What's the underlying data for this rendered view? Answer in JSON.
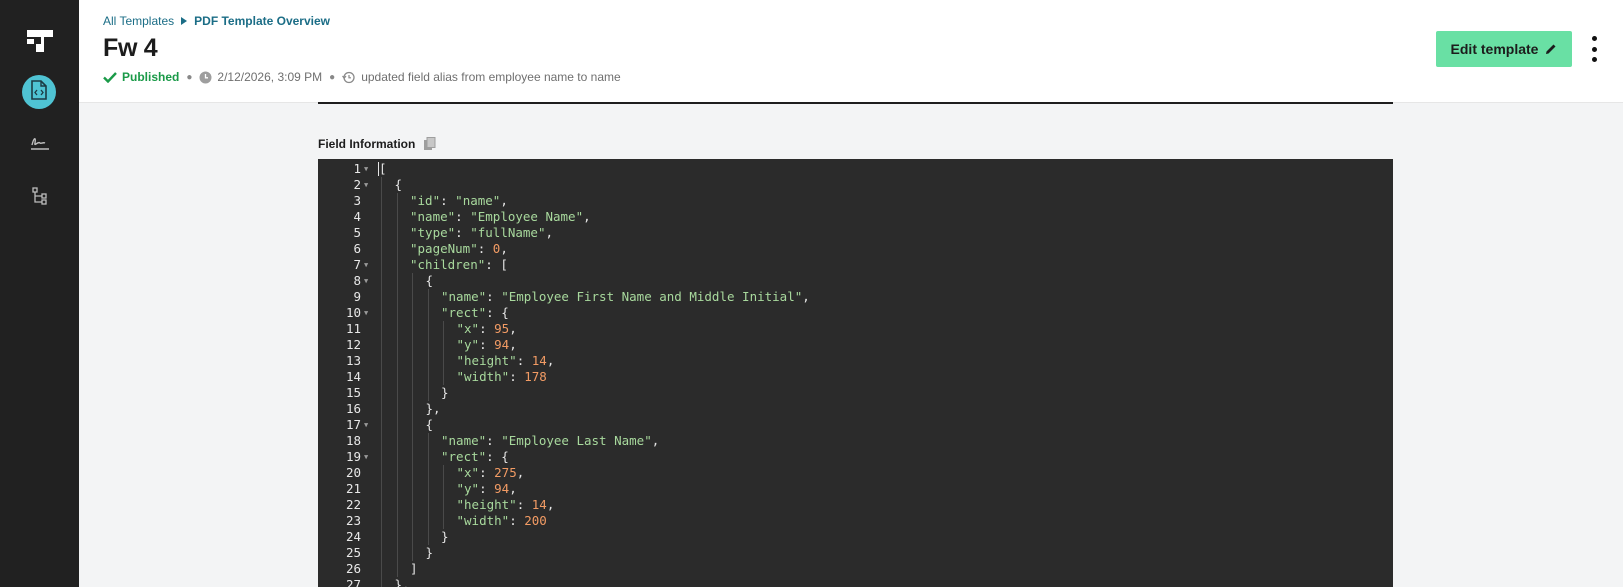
{
  "sidebar": {
    "items": [
      {
        "name": "templates",
        "icon": "file-code-icon",
        "active": true
      },
      {
        "name": "signatures",
        "icon": "signature-icon",
        "active": false
      },
      {
        "name": "workflows",
        "icon": "flow-tree-icon",
        "active": false
      }
    ],
    "accent": "#4fc3d3"
  },
  "header": {
    "breadcrumb": [
      "All Templates",
      "PDF Template Overview"
    ],
    "title": "Fw 4",
    "status": "Published",
    "timestamp": "2/12/2026, 3:09 PM",
    "last_change": "updated field alias from employee name to name",
    "edit_label": "Edit template",
    "edit_color": "#69e0a4"
  },
  "content": {
    "section_label": "Field Information",
    "code_lines": [
      {
        "n": "1",
        "fold": true,
        "indent": 0,
        "tokens": [
          [
            "p",
            "["
          ]
        ]
      },
      {
        "n": "2",
        "fold": true,
        "indent": 1,
        "tokens": [
          [
            "p",
            "{"
          ]
        ]
      },
      {
        "n": "3",
        "fold": false,
        "indent": 2,
        "tokens": [
          [
            "k",
            "\"id\""
          ],
          [
            "p",
            ": "
          ],
          [
            "s",
            "\"name\""
          ],
          [
            "p",
            ","
          ]
        ]
      },
      {
        "n": "4",
        "fold": false,
        "indent": 2,
        "tokens": [
          [
            "k",
            "\"name\""
          ],
          [
            "p",
            ": "
          ],
          [
            "s",
            "\"Employee Name\""
          ],
          [
            "p",
            ","
          ]
        ]
      },
      {
        "n": "5",
        "fold": false,
        "indent": 2,
        "tokens": [
          [
            "k",
            "\"type\""
          ],
          [
            "p",
            ": "
          ],
          [
            "s",
            "\"fullName\""
          ],
          [
            "p",
            ","
          ]
        ]
      },
      {
        "n": "6",
        "fold": false,
        "indent": 2,
        "tokens": [
          [
            "k",
            "\"pageNum\""
          ],
          [
            "p",
            ": "
          ],
          [
            "n",
            "0"
          ],
          [
            "p",
            ","
          ]
        ]
      },
      {
        "n": "7",
        "fold": true,
        "indent": 2,
        "tokens": [
          [
            "k",
            "\"children\""
          ],
          [
            "p",
            ": ["
          ]
        ]
      },
      {
        "n": "8",
        "fold": true,
        "indent": 3,
        "tokens": [
          [
            "p",
            "{"
          ]
        ]
      },
      {
        "n": "9",
        "fold": false,
        "indent": 4,
        "tokens": [
          [
            "k",
            "\"name\""
          ],
          [
            "p",
            ": "
          ],
          [
            "s",
            "\"Employee First Name and Middle Initial\""
          ],
          [
            "p",
            ","
          ]
        ]
      },
      {
        "n": "10",
        "fold": true,
        "indent": 4,
        "tokens": [
          [
            "k",
            "\"rect\""
          ],
          [
            "p",
            ": {"
          ]
        ]
      },
      {
        "n": "11",
        "fold": false,
        "indent": 5,
        "tokens": [
          [
            "k",
            "\"x\""
          ],
          [
            "p",
            ": "
          ],
          [
            "n",
            "95"
          ],
          [
            "p",
            ","
          ]
        ]
      },
      {
        "n": "12",
        "fold": false,
        "indent": 5,
        "tokens": [
          [
            "k",
            "\"y\""
          ],
          [
            "p",
            ": "
          ],
          [
            "n",
            "94"
          ],
          [
            "p",
            ","
          ]
        ]
      },
      {
        "n": "13",
        "fold": false,
        "indent": 5,
        "tokens": [
          [
            "k",
            "\"height\""
          ],
          [
            "p",
            ": "
          ],
          [
            "n",
            "14"
          ],
          [
            "p",
            ","
          ]
        ]
      },
      {
        "n": "14",
        "fold": false,
        "indent": 5,
        "tokens": [
          [
            "k",
            "\"width\""
          ],
          [
            "p",
            ": "
          ],
          [
            "n",
            "178"
          ]
        ]
      },
      {
        "n": "15",
        "fold": false,
        "indent": 4,
        "tokens": [
          [
            "p",
            "}"
          ]
        ]
      },
      {
        "n": "16",
        "fold": false,
        "indent": 3,
        "tokens": [
          [
            "p",
            "},"
          ]
        ]
      },
      {
        "n": "17",
        "fold": true,
        "indent": 3,
        "tokens": [
          [
            "p",
            "{"
          ]
        ]
      },
      {
        "n": "18",
        "fold": false,
        "indent": 4,
        "tokens": [
          [
            "k",
            "\"name\""
          ],
          [
            "p",
            ": "
          ],
          [
            "s",
            "\"Employee Last Name\""
          ],
          [
            "p",
            ","
          ]
        ]
      },
      {
        "n": "19",
        "fold": true,
        "indent": 4,
        "tokens": [
          [
            "k",
            "\"rect\""
          ],
          [
            "p",
            ": {"
          ]
        ]
      },
      {
        "n": "20",
        "fold": false,
        "indent": 5,
        "tokens": [
          [
            "k",
            "\"x\""
          ],
          [
            "p",
            ": "
          ],
          [
            "n",
            "275"
          ],
          [
            "p",
            ","
          ]
        ]
      },
      {
        "n": "21",
        "fold": false,
        "indent": 5,
        "tokens": [
          [
            "k",
            "\"y\""
          ],
          [
            "p",
            ": "
          ],
          [
            "n",
            "94"
          ],
          [
            "p",
            ","
          ]
        ]
      },
      {
        "n": "22",
        "fold": false,
        "indent": 5,
        "tokens": [
          [
            "k",
            "\"height\""
          ],
          [
            "p",
            ": "
          ],
          [
            "n",
            "14"
          ],
          [
            "p",
            ","
          ]
        ]
      },
      {
        "n": "23",
        "fold": false,
        "indent": 5,
        "tokens": [
          [
            "k",
            "\"width\""
          ],
          [
            "p",
            ": "
          ],
          [
            "n",
            "200"
          ]
        ]
      },
      {
        "n": "24",
        "fold": false,
        "indent": 4,
        "tokens": [
          [
            "p",
            "}"
          ]
        ]
      },
      {
        "n": "25",
        "fold": false,
        "indent": 3,
        "tokens": [
          [
            "p",
            "}"
          ]
        ]
      },
      {
        "n": "26",
        "fold": false,
        "indent": 2,
        "tokens": [
          [
            "p",
            "]"
          ]
        ]
      },
      {
        "n": "27",
        "fold": false,
        "indent": 1,
        "tokens": [
          [
            "p",
            "},"
          ]
        ]
      }
    ]
  }
}
